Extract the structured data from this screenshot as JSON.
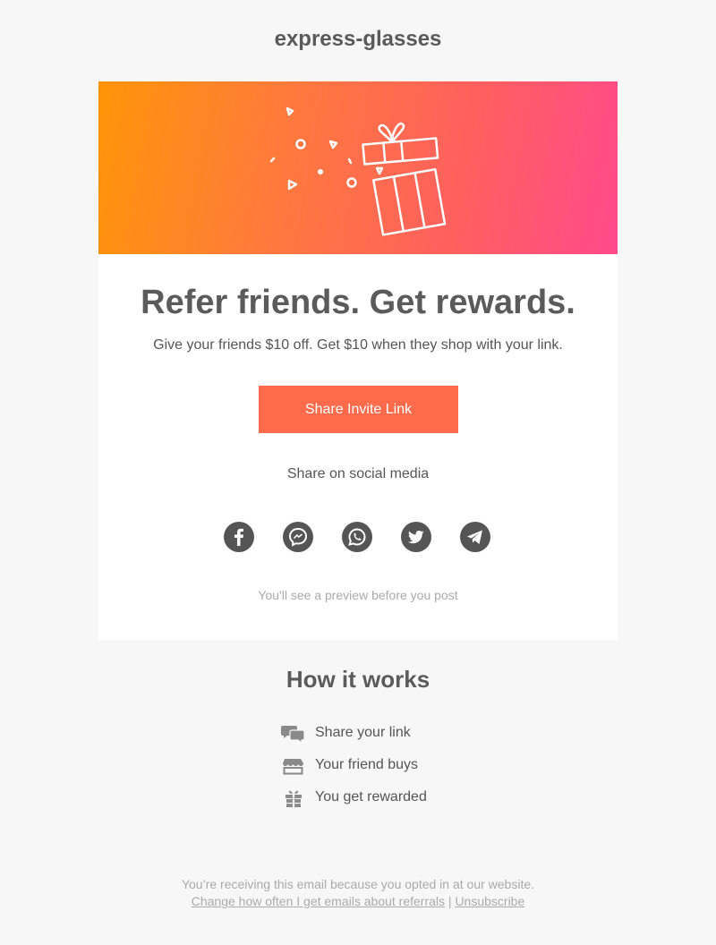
{
  "header": {
    "brand": "express-glasses"
  },
  "hero": {
    "illustration": "gift-confetti-icon",
    "gradient_colors": [
      "#ff9508",
      "#ff4a8c"
    ]
  },
  "main": {
    "headline": "Refer friends. Get rewards.",
    "subtext": "Give your friends $10 off. Get $10 when they shop with your link.",
    "cta_label": "Share Invite Link",
    "cta_color": "#ff6b4b",
    "social_label": "Share on social media",
    "social": [
      {
        "name": "facebook",
        "icon": "facebook-icon"
      },
      {
        "name": "messenger",
        "icon": "messenger-icon"
      },
      {
        "name": "whatsapp",
        "icon": "whatsapp-icon"
      },
      {
        "name": "twitter",
        "icon": "twitter-icon"
      },
      {
        "name": "telegram",
        "icon": "telegram-icon"
      }
    ],
    "preview_note": "You'll see a preview before you post"
  },
  "how_it_works": {
    "title": "How it works",
    "steps": [
      {
        "icon": "chat-bubbles-icon",
        "label": "Share your link"
      },
      {
        "icon": "storefront-icon",
        "label": "Your friend buys"
      },
      {
        "icon": "gift-icon",
        "label": "You get rewarded"
      }
    ]
  },
  "footer": {
    "notice": "You’re receiving this email because you opted in at our website.",
    "change_link": "Change how often I get emails about referrals",
    "separator": "|",
    "unsubscribe_link": "Unsubscribe"
  }
}
